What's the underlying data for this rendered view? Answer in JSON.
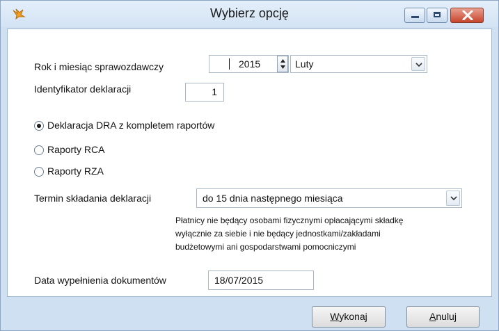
{
  "window": {
    "title": "Wybierz opcję"
  },
  "fields": {
    "period_label": "Rok i miesiąc sprawozdawczy",
    "year": "2015",
    "month": "Luty",
    "identifier_label": "Identyfikator deklaracji",
    "identifier": "1",
    "deadline_label": "Termin składania deklaracji",
    "deadline": "do 15 dnia następnego miesiąca",
    "note_lines": [
      "Płatnicy nie będący osobami fizycznymi opłacającymi składkę",
      "wyłącznie za siebie i nie będący jednostkami/zakładami",
      "budżetowymi ani gospodarstwami pomocniczymi"
    ],
    "date_label": "Data wypełnienia dokumentów",
    "date": "18/07/2015"
  },
  "options": [
    {
      "label": "Deklaracja DRA z kompletem raportów",
      "selected": true
    },
    {
      "label": "Raporty RCA",
      "selected": false
    },
    {
      "label": "Raporty RZA",
      "selected": false
    }
  ],
  "buttons": {
    "execute": {
      "mnemonic": "W",
      "rest": "ykonaj"
    },
    "cancel": {
      "mnemonic": "A",
      "rest": "nuluj"
    }
  },
  "icons": {
    "app": "pencil-bird-icon",
    "minimize": "minimize-icon",
    "maximize": "maximize-icon",
    "close": "close-icon",
    "spin": "spin-updown-icon",
    "dropdown": "chevron-down-icon"
  },
  "colors": {
    "frame": "#cfe0f2",
    "close_button": "#c8452c"
  }
}
